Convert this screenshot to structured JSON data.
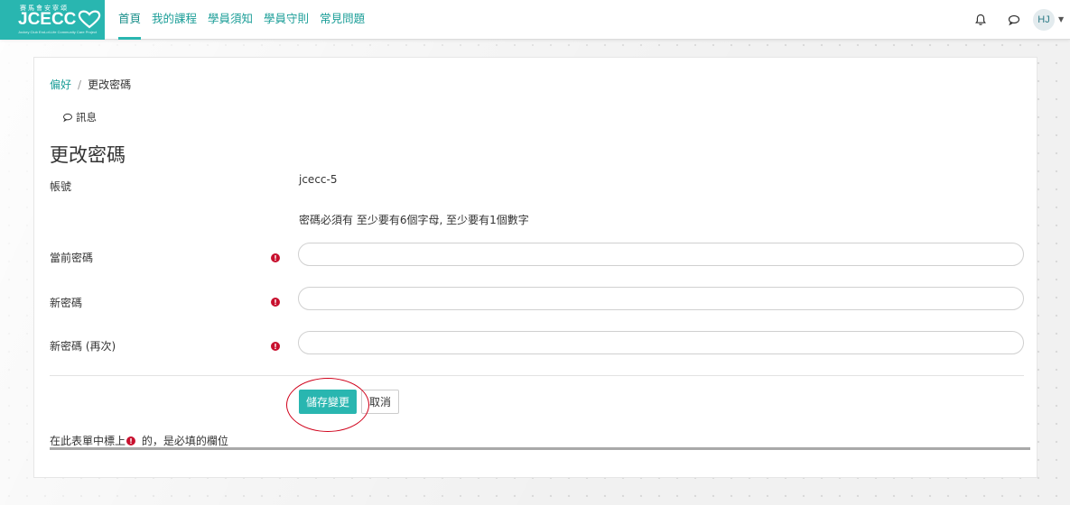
{
  "brand": {
    "logo_cn": "賽馬會安寧頌",
    "logo_main": "JCECC",
    "logo_sub": "Jockey Club End-of-Life Community Care Project",
    "color": "#29b6b0"
  },
  "nav": {
    "items": [
      {
        "label": "首頁",
        "active": true
      },
      {
        "label": "我的課程"
      },
      {
        "label": "學員須知"
      },
      {
        "label": "學員守則"
      },
      {
        "label": "常見問題"
      }
    ],
    "icons": [
      "bell-icon",
      "chat-icon"
    ],
    "avatar_initials": "HJ"
  },
  "breadcrumb": {
    "items": [
      "偏好",
      "更改密碼"
    ],
    "separator": "/"
  },
  "message_link": "訊息",
  "page": {
    "title": "更改密碼"
  },
  "form": {
    "username_label": "帳號",
    "username_value": "jcecc-5",
    "password_policy": "密碼必須有 至少要有6個字母, 至少要有1個數字",
    "fields": [
      {
        "label": "當前密碼",
        "value": "",
        "required": true
      },
      {
        "label": "新密碼",
        "value": "",
        "required": true
      },
      {
        "label": "新密碼 (再次)",
        "value": "",
        "required": true
      }
    ],
    "save_label": "儲存變更",
    "cancel_label": "取消",
    "required_note_prefix": "在此表單中標上",
    "required_note_suffix": " 的，是必填的欄位"
  },
  "colors": {
    "accent": "#29b6b0",
    "required": "#c8102e",
    "annotation": "#d0021b"
  }
}
